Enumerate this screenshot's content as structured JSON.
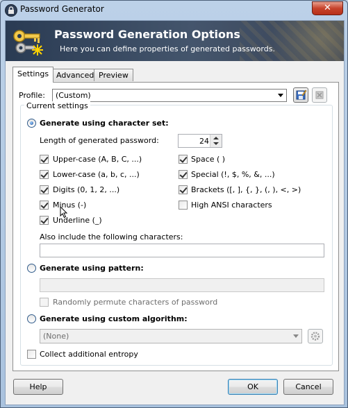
{
  "window": {
    "title": "Password Generator",
    "close_label": "✕"
  },
  "banner": {
    "title": "Password Generation Options",
    "subtitle": "Here you can define properties of generated passwords."
  },
  "tabs": [
    {
      "label": "Settings",
      "active": true
    },
    {
      "label": "Advanced",
      "active": false
    },
    {
      "label": "Preview",
      "active": false
    }
  ],
  "profile": {
    "label": "Profile:",
    "value": "(Custom)"
  },
  "current_settings": {
    "caption": "Current settings",
    "charset": {
      "label": "Generate using character set:",
      "selected": true,
      "length_label": "Length of generated password:",
      "length_value": "24",
      "options_left": [
        {
          "label": "Upper-case (A, B, C, ...)",
          "checked": true
        },
        {
          "label": "Lower-case (a, b, c, ...)",
          "checked": true
        },
        {
          "label": "Digits (0, 1, 2, ...)",
          "checked": true
        },
        {
          "label": "Minus (-)",
          "checked": true
        },
        {
          "label": "Underline (_)",
          "checked": true
        }
      ],
      "options_right": [
        {
          "label": "Space ( )",
          "checked": true
        },
        {
          "label": "Special (!, $, %, &, ...)",
          "checked": true
        },
        {
          "label": "Brackets ([, ], {, }, (, ), <, >)",
          "checked": true
        },
        {
          "label": "High ANSI characters",
          "checked": false
        }
      ],
      "also_include_label": "Also include the following characters:",
      "also_include_value": ""
    },
    "pattern": {
      "label": "Generate using pattern:",
      "selected": false,
      "value": "",
      "permute_label": "Randomly permute characters of password",
      "permute_checked": false
    },
    "custom": {
      "label": "Generate using custom algorithm:",
      "selected": false,
      "value": "(None)"
    },
    "entropy": {
      "label": "Collect additional entropy",
      "checked": false
    }
  },
  "buttons": {
    "help": "Help",
    "ok": "OK",
    "cancel": "Cancel"
  }
}
